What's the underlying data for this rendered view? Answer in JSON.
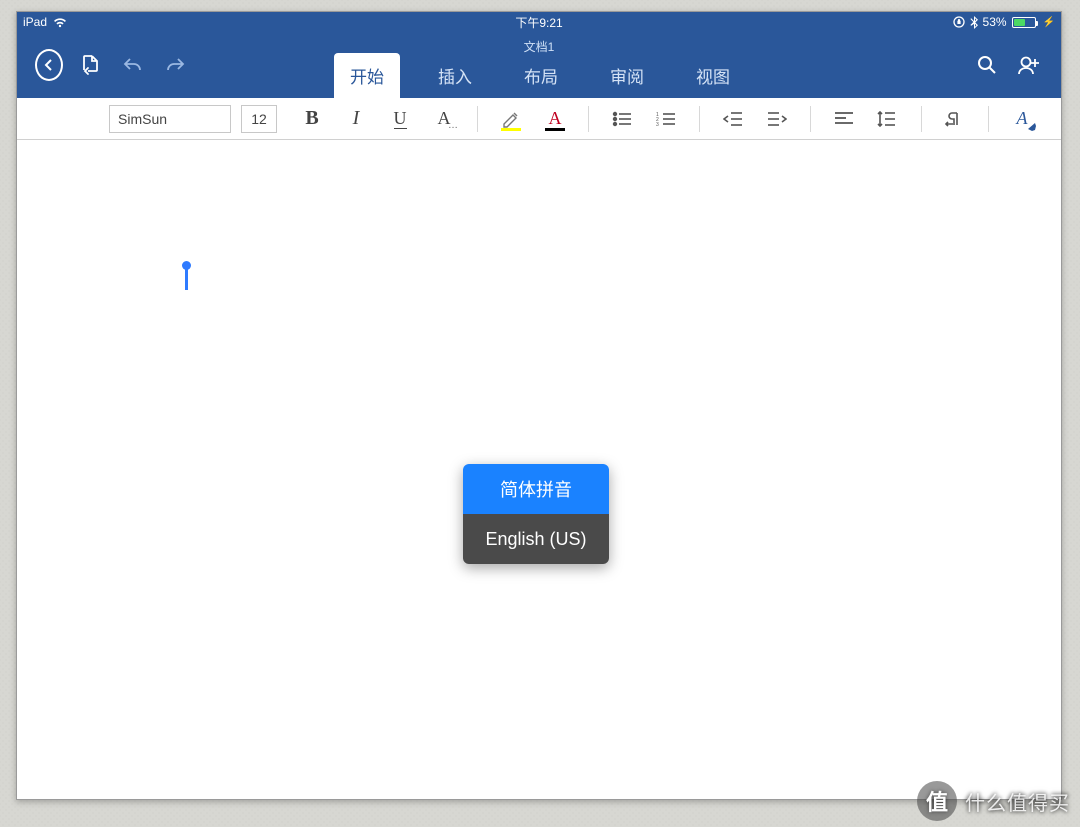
{
  "status": {
    "device": "iPad",
    "time": "下午9:21",
    "battery_pct": "53%"
  },
  "doc_title": "文档1",
  "tabs": {
    "start": "开始",
    "insert": "插入",
    "layout": "布局",
    "review": "审阅",
    "view": "视图"
  },
  "ribbon": {
    "font_name": "SimSun",
    "font_size": "12",
    "bold": "B",
    "italic": "I",
    "underline": "U",
    "font_opts": "A",
    "highlight": "A",
    "font_color": "A",
    "styles": "A"
  },
  "ime": {
    "opt1": "简体拼音",
    "opt2": "English (US)"
  },
  "watermark": {
    "badge": "值",
    "text": "什么值得买"
  }
}
